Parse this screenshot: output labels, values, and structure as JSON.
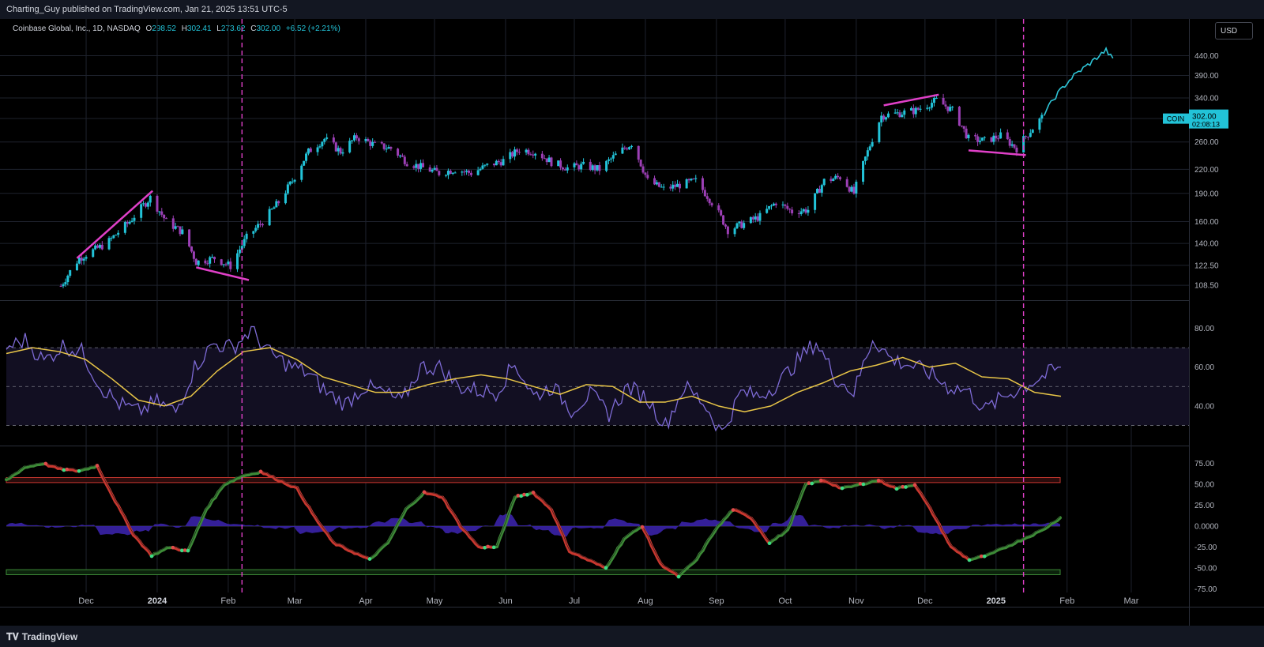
{
  "header": {
    "publisher": "Charting_Guy published on TradingView.com, Jan 21, 2025 13:51 UTC-5"
  },
  "legend": {
    "symbol": "Coinbase Global, Inc., 1D, NASDAQ",
    "o_label": "O",
    "o_value": "298.52",
    "h_label": "H",
    "h_value": "302.41",
    "l_label": "L",
    "l_value": "273.62",
    "c_label": "C",
    "c_value": "302.00",
    "change": "+6.52 (+2.21%)"
  },
  "currency_button": "USD",
  "price_tag": {
    "symbol": "COIN",
    "price": "302.00",
    "countdown": "02:08:13"
  },
  "footer": {
    "logo_text": "TradingView"
  },
  "colors": {
    "up": "#22c3d8",
    "down": "#9c3fb5",
    "line": "#2ec4d6",
    "trendline": "#e040c8",
    "rsi": "#7e6bd6",
    "rsi_ma": "#e8c547",
    "osc_pos": "#3d8b37",
    "osc_neg": "#c8372f",
    "histogram": "#3a22a8"
  },
  "chart_data": [
    {
      "type": "candlestick",
      "title": "Coinbase Global, Inc., 1D, NASDAQ",
      "yaxis_scale": "log",
      "y_ticks": [
        "440.00",
        "390.00",
        "340.00",
        "300.00",
        "260.00",
        "220.00",
        "190.00",
        "160.00",
        "140.00",
        "122.50",
        "108.50"
      ],
      "x_ticks": [
        "Dec",
        "2024",
        "Feb",
        "Mar",
        "Apr",
        "May",
        "Jun",
        "Jul",
        "Aug",
        "Sep",
        "Oct",
        "Nov",
        "Dec",
        "2025",
        "Feb",
        "Mar"
      ],
      "x_ticks_bold": [
        "2024",
        "2025"
      ],
      "approx_close_series": [
        {
          "x": "2023-11-20",
          "y": 108
        },
        {
          "x": "2023-11-28",
          "y": 128
        },
        {
          "x": "2023-12-10",
          "y": 140
        },
        {
          "x": "2023-12-20",
          "y": 160
        },
        {
          "x": "2023-12-29",
          "y": 185
        },
        {
          "x": "2024-01-05",
          "y": 160
        },
        {
          "x": "2024-01-12",
          "y": 150
        },
        {
          "x": "2024-01-18",
          "y": 125
        },
        {
          "x": "2024-01-26",
          "y": 128
        },
        {
          "x": "2024-02-02",
          "y": 122
        },
        {
          "x": "2024-02-09",
          "y": 145
        },
        {
          "x": "2024-02-16",
          "y": 160
        },
        {
          "x": "2024-02-23",
          "y": 180
        },
        {
          "x": "2024-02-29",
          "y": 205
        },
        {
          "x": "2024-03-07",
          "y": 245
        },
        {
          "x": "2024-03-14",
          "y": 265
        },
        {
          "x": "2024-03-21",
          "y": 245
        },
        {
          "x": "2024-03-28",
          "y": 268
        },
        {
          "x": "2024-04-05",
          "y": 255
        },
        {
          "x": "2024-04-12",
          "y": 250
        },
        {
          "x": "2024-04-19",
          "y": 230
        },
        {
          "x": "2024-04-26",
          "y": 222
        },
        {
          "x": "2024-05-03",
          "y": 215
        },
        {
          "x": "2024-05-10",
          "y": 220
        },
        {
          "x": "2024-05-17",
          "y": 215
        },
        {
          "x": "2024-05-24",
          "y": 225
        },
        {
          "x": "2024-05-31",
          "y": 232
        },
        {
          "x": "2024-06-07",
          "y": 248
        },
        {
          "x": "2024-06-14",
          "y": 245
        },
        {
          "x": "2024-06-21",
          "y": 230
        },
        {
          "x": "2024-06-28",
          "y": 222
        },
        {
          "x": "2024-07-05",
          "y": 225
        },
        {
          "x": "2024-07-12",
          "y": 220
        },
        {
          "x": "2024-07-19",
          "y": 240
        },
        {
          "x": "2024-07-26",
          "y": 258
        },
        {
          "x": "2024-08-02",
          "y": 205
        },
        {
          "x": "2024-08-09",
          "y": 195
        },
        {
          "x": "2024-08-16",
          "y": 200
        },
        {
          "x": "2024-08-23",
          "y": 205
        },
        {
          "x": "2024-08-30",
          "y": 180
        },
        {
          "x": "2024-09-06",
          "y": 152
        },
        {
          "x": "2024-09-13",
          "y": 158
        },
        {
          "x": "2024-09-20",
          "y": 165
        },
        {
          "x": "2024-09-27",
          "y": 180
        },
        {
          "x": "2024-10-04",
          "y": 170
        },
        {
          "x": "2024-10-11",
          "y": 172
        },
        {
          "x": "2024-10-18",
          "y": 205
        },
        {
          "x": "2024-10-25",
          "y": 210
        },
        {
          "x": "2024-10-31",
          "y": 190
        },
        {
          "x": "2024-11-06",
          "y": 245
        },
        {
          "x": "2024-11-12",
          "y": 305
        },
        {
          "x": "2024-11-20",
          "y": 310
        },
        {
          "x": "2024-11-27",
          "y": 315
        },
        {
          "x": "2024-12-06",
          "y": 335
        },
        {
          "x": "2024-12-13",
          "y": 315
        },
        {
          "x": "2024-12-20",
          "y": 265
        },
        {
          "x": "2024-12-27",
          "y": 262
        },
        {
          "x": "2025-01-03",
          "y": 270
        },
        {
          "x": "2025-01-10",
          "y": 250
        },
        {
          "x": "2025-01-21",
          "y": 302
        },
        {
          "x": "2025-01-28",
          "y": 350
        },
        {
          "x": "2025-02-04",
          "y": 390
        },
        {
          "x": "2025-02-11",
          "y": 420
        },
        {
          "x": "2025-02-18",
          "y": 455
        },
        {
          "x": "2025-02-21",
          "y": 430
        }
      ],
      "last_price": 302.0,
      "markers": [
        "projection line after 2025-01-21 drawn in cyan"
      ],
      "annotations": [
        "rising trendline Dec 2023",
        "falling trendline Jan 2024",
        "rising trendline Nov 2024",
        "falling trendline Jan 2025",
        "vertical dashed line ~2024-02-07",
        "vertical dashed line ~2025-01-13"
      ]
    },
    {
      "type": "line",
      "title": "RSI",
      "y_ticks": [
        "80.00",
        "60.00",
        "40.00"
      ],
      "bands": [
        30,
        50,
        70
      ],
      "series": [
        {
          "values": [
            70,
            74,
            63,
            71,
            68,
            50,
            41,
            37,
            42,
            37,
            60,
            72,
            70,
            79,
            67,
            61,
            57,
            47,
            41,
            50,
            47,
            42,
            60,
            60,
            50,
            48,
            47,
            62,
            45,
            50,
            38,
            46,
            36,
            50,
            44,
            30,
            50,
            42,
            26,
            47,
            45,
            52,
            63,
            73,
            55,
            47,
            75,
            64,
            61,
            57,
            50,
            48,
            38,
            45,
            50,
            55,
            60
          ]
        },
        {
          "values": [
            67,
            70,
            68,
            64,
            54,
            43,
            40,
            45,
            58,
            68,
            70,
            64,
            55,
            51,
            47,
            47,
            51,
            54,
            56,
            54,
            50,
            46,
            51,
            50,
            42,
            42,
            45,
            40,
            37,
            40,
            47,
            52,
            58,
            61,
            65,
            60,
            62,
            55,
            54,
            47,
            45
          ]
        }
      ]
    },
    {
      "type": "area",
      "title": "Momentum Oscillator",
      "y_ticks": [
        "75.00",
        "50.00",
        "25.00",
        "0.0000",
        "-25.00",
        "-50.00",
        "-75.00"
      ],
      "bands": [
        {
          "upper": [
            52,
            58
          ]
        },
        {
          "lower": [
            -52,
            -58
          ]
        }
      ],
      "series": [
        {
          "values": [
            55,
            70,
            75,
            68,
            66,
            72,
            30,
            -10,
            -35,
            -25,
            -30,
            20,
            50,
            60,
            65,
            55,
            45,
            10,
            -20,
            -30,
            -40,
            -20,
            20,
            40,
            35,
            0,
            -25,
            -25,
            35,
            40,
            20,
            -30,
            -40,
            -50,
            -15,
            0,
            -45,
            -60,
            -40,
            -5,
            20,
            10,
            -20,
            -5,
            50,
            55,
            45,
            50,
            55,
            45,
            50,
            15,
            -25,
            -40,
            -35,
            -25,
            -15,
            -5,
            10
          ]
        }
      ]
    }
  ]
}
